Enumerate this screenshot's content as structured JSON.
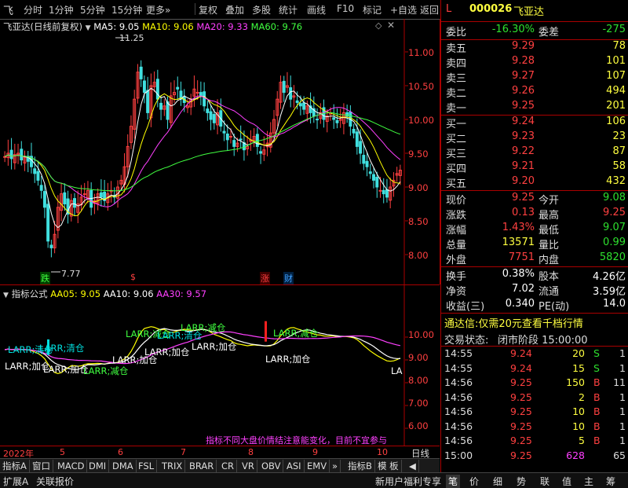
{
  "toolbar": {
    "logo": "飞",
    "items": [
      "分时",
      "1分钟",
      "5分钟",
      "15分钟",
      "更多»",
      "复权",
      "叠加",
      "多股",
      "统计",
      "画线",
      "F10",
      "标记",
      "+自选",
      "返回"
    ]
  },
  "main_chart": {
    "title": "飞亚达(日线前复权)",
    "ma_labels": [
      {
        "text": "MA5: 9.05",
        "color": "#ffffff"
      },
      {
        "text": "MA10: 9.06",
        "color": "#ffff00"
      },
      {
        "text": "MA20: 9.33",
        "color": "#ff40ff"
      },
      {
        "text": "MA60: 9.76",
        "color": "#40ff40"
      }
    ],
    "high_mark": "11.25",
    "low_mark": "7.77",
    "price_axis": [
      "11.00",
      "10.50",
      "10.00",
      "9.50",
      "9.00",
      "8.50",
      "8.00"
    ],
    "event_labels": [
      {
        "text": "跌",
        "color": "#40ff40"
      },
      {
        "text": "$",
        "color": "#ff4040"
      },
      {
        "text": "涨",
        "color": "#ff4040"
      },
      {
        "text": "财",
        "color": "#40a0ff"
      }
    ]
  },
  "indicator_chart": {
    "title": "指标公式",
    "labels": [
      {
        "text": "AA05: 9.05",
        "color": "#ffff00"
      },
      {
        "text": "AA10: 9.06",
        "color": "#ffffff"
      },
      {
        "text": "AA30: 9.57",
        "color": "#ff40ff"
      }
    ],
    "axis": [
      "10.00",
      "9.00",
      "8.00",
      "7.00",
      "6.00"
    ],
    "annotations": [
      {
        "text": "LARR;清仓",
        "color": "#00e0e0"
      },
      {
        "text": "LARR;清仓",
        "color": "#00e0e0"
      },
      {
        "text": "LARR;加仓",
        "color": "#ffffff"
      },
      {
        "text": "LARR;加仓",
        "color": "#ffffff"
      },
      {
        "text": "LARR;减仓",
        "color": "#40ff40"
      },
      {
        "text": "LARR;加仓",
        "color": "#ffffff"
      },
      {
        "text": "LARR;加仓",
        "color": "#ffffff"
      },
      {
        "text": "LARR;减仓",
        "color": "#40ff40"
      },
      {
        "text": "LARR;清仓",
        "color": "#00e0e0"
      },
      {
        "text": "LARR;加仓",
        "color": "#ffffff"
      },
      {
        "text": "LARR;减仓",
        "color": "#40ff40"
      },
      {
        "text": "LARR;加仓",
        "color": "#ffffff"
      },
      {
        "text": "LARR;减仓",
        "color": "#40ff40"
      },
      {
        "text": "LA",
        "color": "#ffffff"
      }
    ],
    "footer_note": "指标不同大盘价情结注意能变化，目前不宜参与"
  },
  "x_axis": {
    "labels": [
      "2022年",
      "5",
      "6",
      "7",
      "8",
      "9",
      "10"
    ],
    "period": "日线"
  },
  "tabs": [
    "指标A",
    "窗口",
    "MACD",
    "DMI",
    "DMA",
    "FSL",
    "TRIX",
    "BRAR",
    "CR",
    "VR",
    "OBV",
    "ASI",
    "EMV",
    "»",
    "指标B",
    "模 板",
    "◀"
  ],
  "bottom_bar": {
    "left": [
      "扩展A",
      "关联报价"
    ],
    "center": "新用户福利专享",
    "right": [
      "笔",
      "价",
      "细",
      "势",
      "联",
      "值",
      "主",
      "筹"
    ]
  },
  "quote_panel": {
    "marker": "L",
    "code": "000026",
    "name": "飞亚达",
    "weibi_label": "委比",
    "weibi": "-16.30%",
    "weicha_label": "委差",
    "weicha": "-275",
    "asks": [
      {
        "label": "卖五",
        "price": "9.29",
        "vol": "78"
      },
      {
        "label": "卖四",
        "price": "9.28",
        "vol": "101"
      },
      {
        "label": "卖三",
        "price": "9.27",
        "vol": "107"
      },
      {
        "label": "卖二",
        "price": "9.26",
        "vol": "494"
      },
      {
        "label": "卖一",
        "price": "9.25",
        "vol": "201"
      }
    ],
    "bids": [
      {
        "label": "买一",
        "price": "9.24",
        "vol": "106"
      },
      {
        "label": "买二",
        "price": "9.23",
        "vol": "23"
      },
      {
        "label": "买三",
        "price": "9.22",
        "vol": "87"
      },
      {
        "label": "买四",
        "price": "9.21",
        "vol": "58"
      },
      {
        "label": "买五",
        "price": "9.20",
        "vol": "432"
      }
    ],
    "stats": [
      {
        "l1": "现价",
        "v1": "9.25",
        "c1": "#ff4040",
        "l2": "今开",
        "v2": "9.08",
        "c2": "#2ee02e"
      },
      {
        "l1": "涨跌",
        "v1": "0.13",
        "c1": "#ff4040",
        "l2": "最高",
        "v2": "9.25",
        "c2": "#ff4040"
      },
      {
        "l1": "涨幅",
        "v1": "1.43%",
        "c1": "#ff4040",
        "l2": "最低",
        "v2": "9.07",
        "c2": "#2ee02e"
      },
      {
        "l1": "总量",
        "v1": "13571",
        "c1": "#ffff40",
        "l2": "量比",
        "v2": "0.99",
        "c2": "#2ee02e"
      },
      {
        "l1": "外盘",
        "v1": "7751",
        "c1": "#ff4040",
        "l2": "内盘",
        "v2": "5820",
        "c2": "#2ee02e"
      }
    ],
    "fin": [
      {
        "l1": "换手",
        "v1": "0.38%",
        "l2": "股本",
        "v2": "4.26亿"
      },
      {
        "l1": "净资",
        "v1": "7.02",
        "l2": "流通",
        "v2": "3.59亿"
      },
      {
        "l1": "收益(三)",
        "v1": "0.340",
        "l2": "PE(动)",
        "v2": "14.0"
      }
    ],
    "promo": "通达信:仅需20元查看千档行情",
    "status_label": "交易状态:",
    "status": "闭市阶段 15:00:00",
    "ticks": [
      {
        "time": "14:55",
        "price": "9.24",
        "vol": "20",
        "side": "S",
        "n": "1"
      },
      {
        "time": "14:55",
        "price": "9.24",
        "vol": "15",
        "side": "S",
        "n": "1"
      },
      {
        "time": "14:56",
        "price": "9.25",
        "vol": "150",
        "side": "B",
        "n": "11"
      },
      {
        "time": "14:56",
        "price": "9.25",
        "vol": "2",
        "side": "B",
        "n": "1"
      },
      {
        "time": "14:56",
        "price": "9.25",
        "vol": "10",
        "side": "B",
        "n": "1"
      },
      {
        "time": "14:56",
        "price": "9.25",
        "vol": "10",
        "side": "B",
        "n": "1"
      },
      {
        "time": "14:56",
        "price": "9.25",
        "vol": "5",
        "side": "B",
        "n": "1"
      },
      {
        "time": "15:00",
        "price": "9.25",
        "vol": "628",
        "side": "",
        "n": "65"
      }
    ]
  }
}
